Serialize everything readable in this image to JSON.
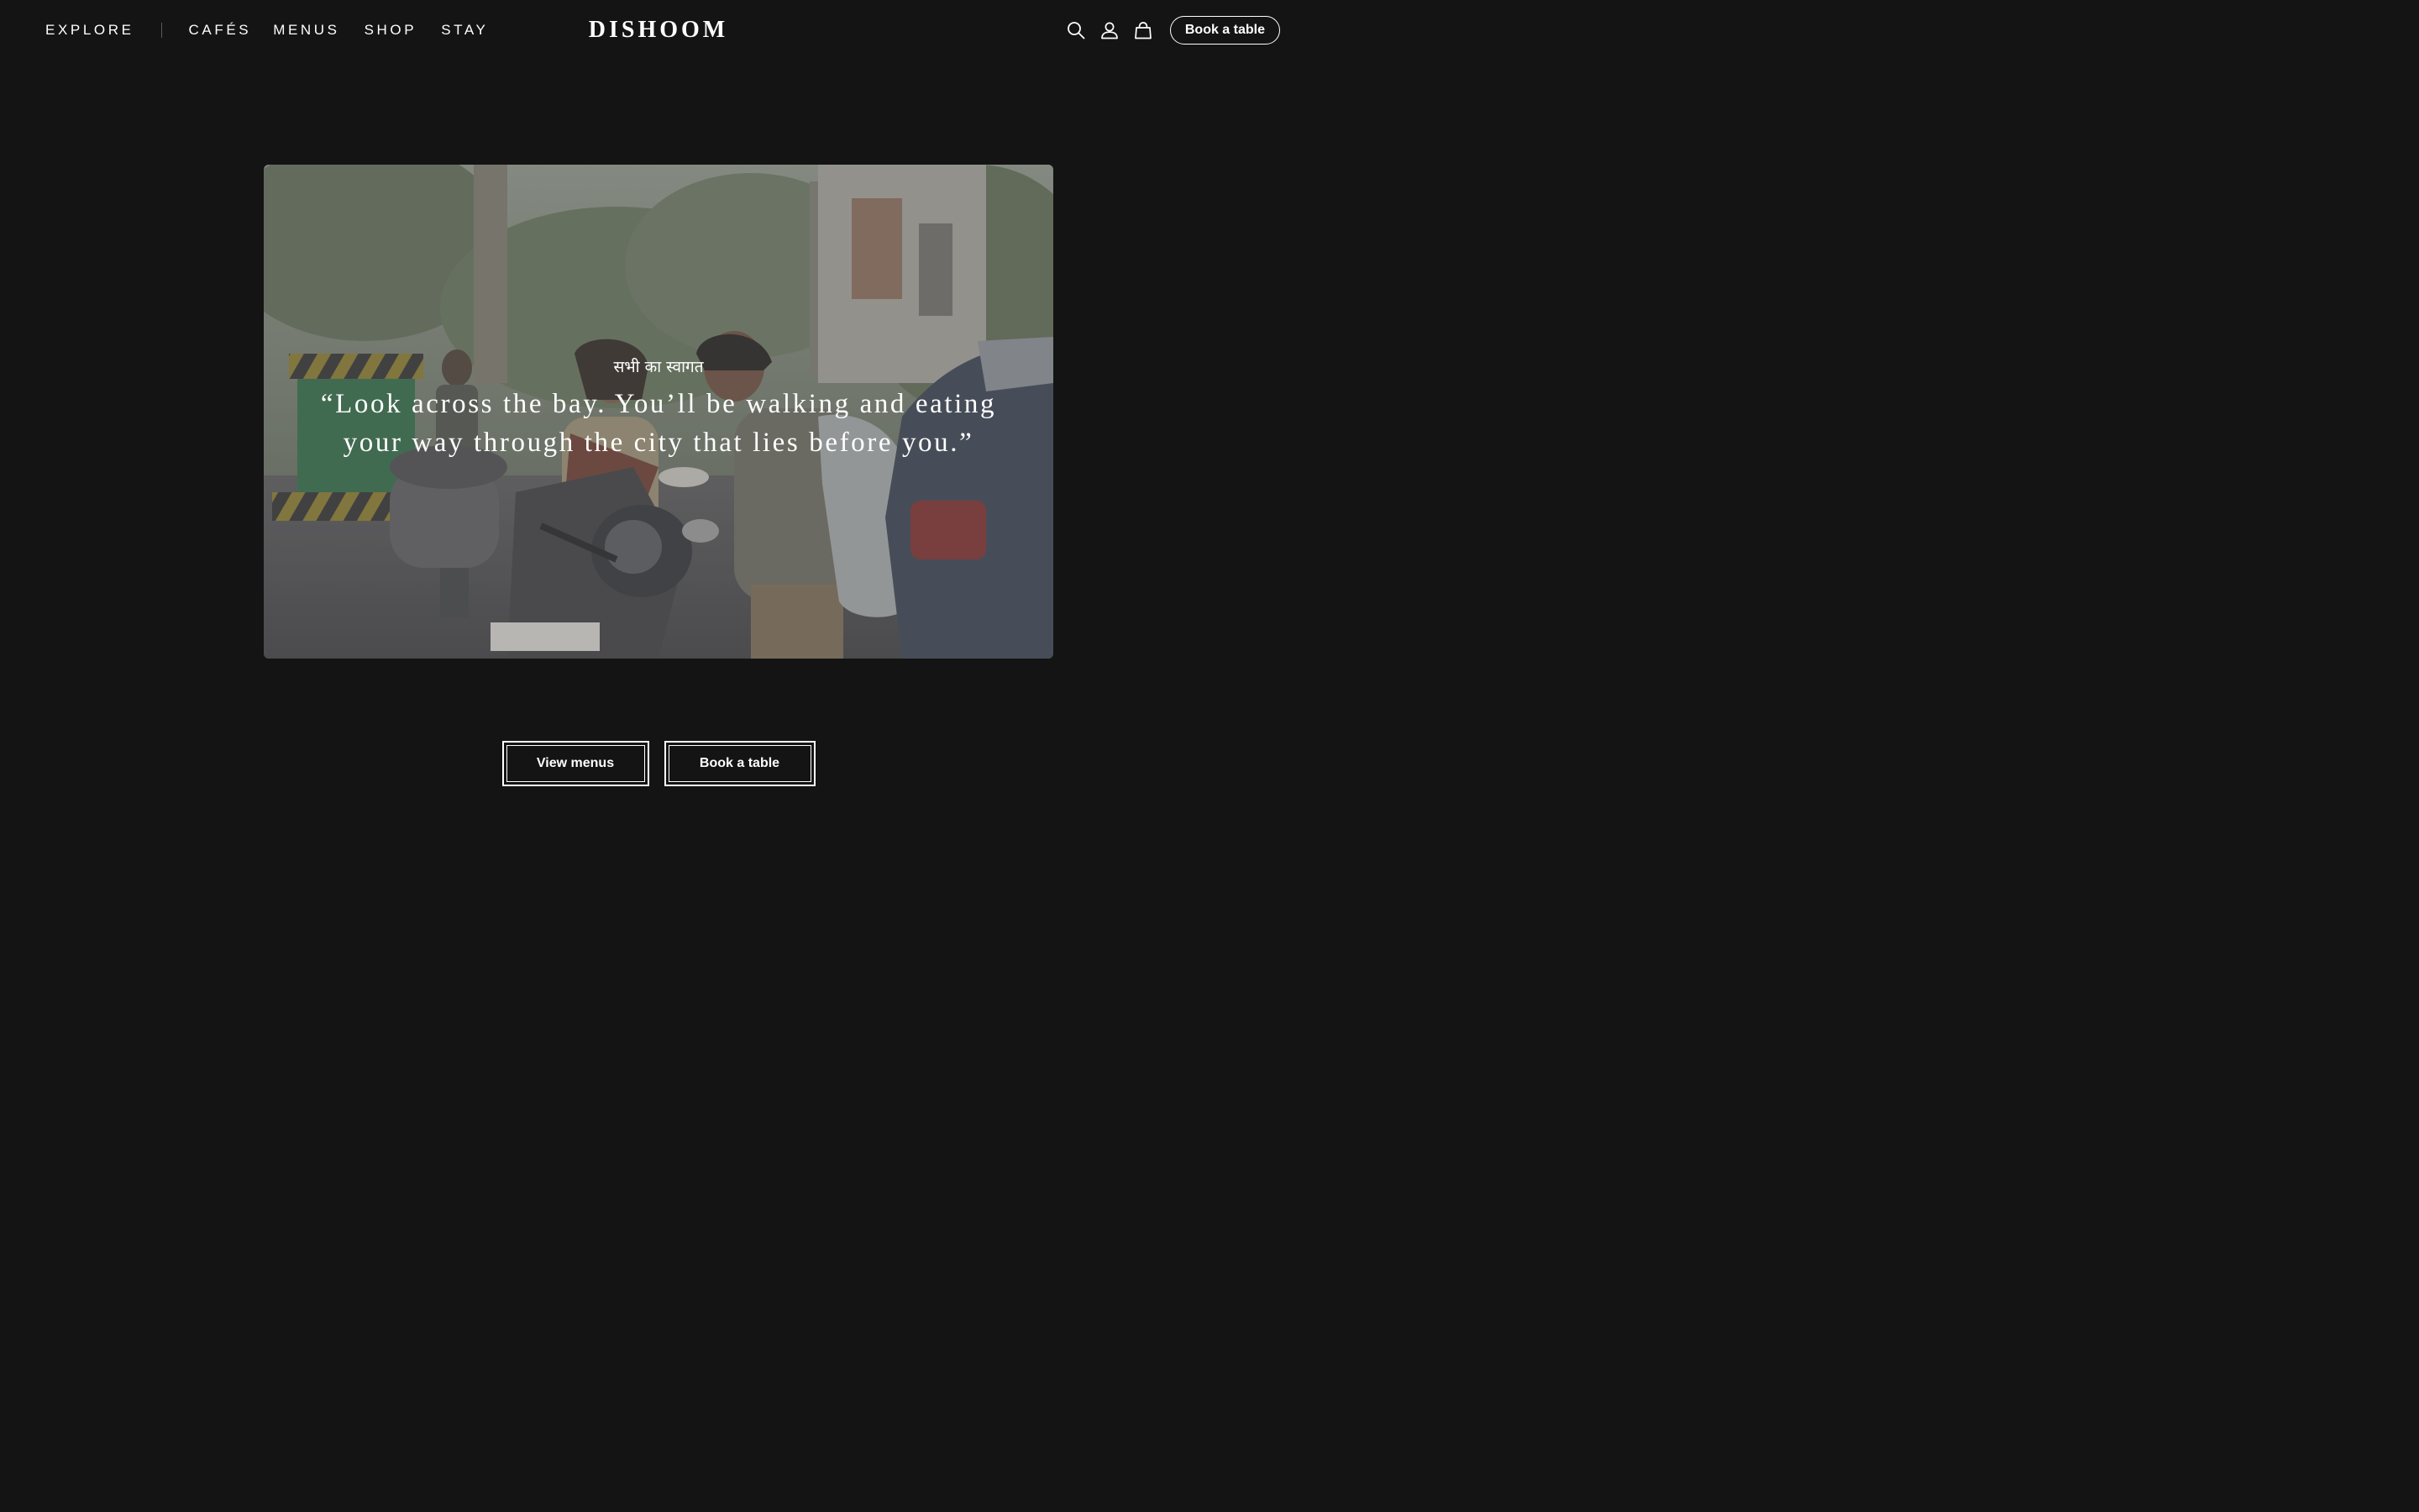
{
  "header": {
    "nav_left": {
      "explore": "EXPLORE",
      "cafes": "CAFÉS",
      "menus": "MENUS",
      "shop": "SHOP",
      "stay": "STAY"
    },
    "logo": "DISHOOM",
    "icons": [
      "search-icon",
      "account-icon",
      "bag-icon"
    ],
    "book_button": "Book a table"
  },
  "hero": {
    "kicker": "सभी का स्वागत",
    "quote": "“Look across the bay. You’ll be walking and eating your way through the city that lies before you.”"
  },
  "cta": {
    "view_menus": "View menus",
    "book_table": "Book a table"
  },
  "colors": {
    "background": "#141414",
    "text": "#ffffff",
    "divider": "#5a5a5a"
  }
}
